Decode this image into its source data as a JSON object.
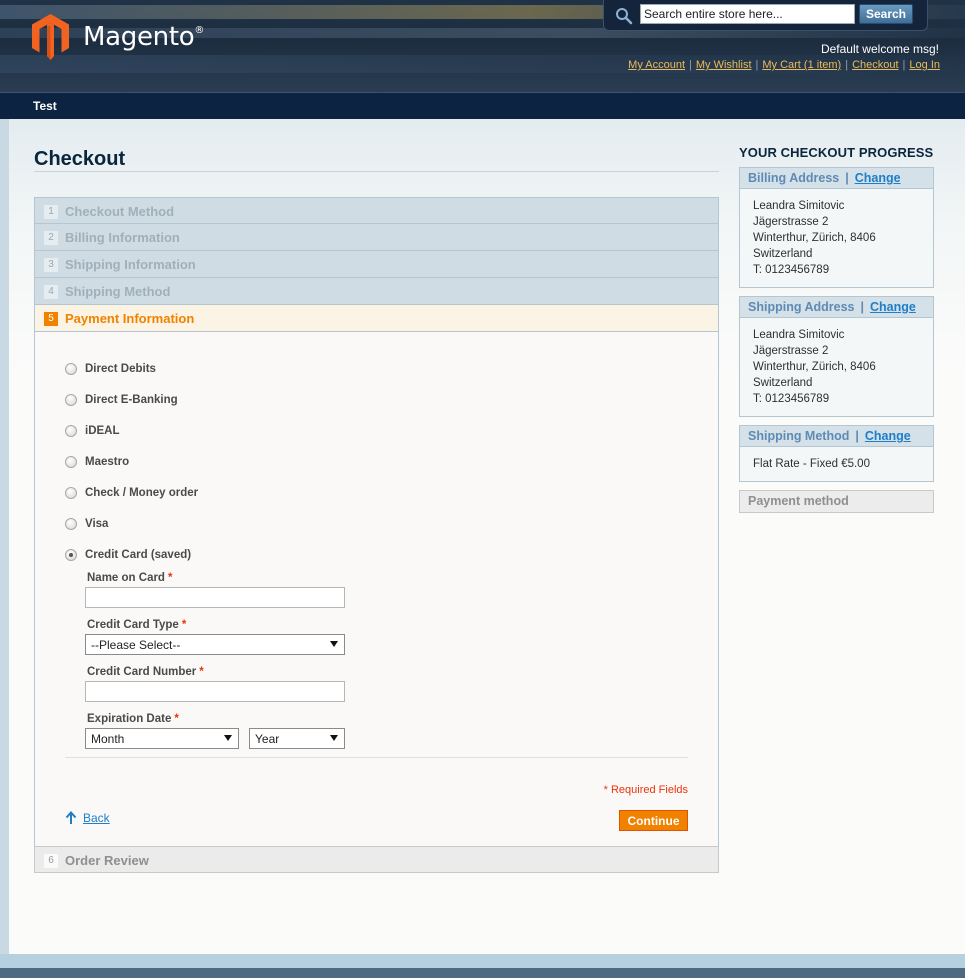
{
  "header": {
    "logo_text": "Magento",
    "logo_reg": "®",
    "search_placeholder": "Search entire store here...",
    "search_button": "Search",
    "welcome": "Default welcome msg!",
    "links": [
      "My Account",
      "My Wishlist",
      "My Cart (1 item)",
      "Checkout",
      "Log In"
    ],
    "separator": "|"
  },
  "nav": {
    "item": "Test"
  },
  "page": {
    "title": "Checkout"
  },
  "steps": [
    {
      "num": "1",
      "label": "Checkout Method"
    },
    {
      "num": "2",
      "label": "Billing Information"
    },
    {
      "num": "3",
      "label": "Shipping Information"
    },
    {
      "num": "4",
      "label": "Shipping Method"
    },
    {
      "num": "5",
      "label": "Payment Information"
    },
    {
      "num": "6",
      "label": "Order Review"
    }
  ],
  "payment": {
    "methods": [
      "Direct Debits",
      "Direct E-Banking",
      "iDEAL",
      "Maestro",
      "Check / Money order",
      "Visa",
      "Credit Card (saved)"
    ],
    "selected": "Credit Card (saved)",
    "fields": {
      "name_label": "Name on Card",
      "type_label": "Credit Card Type",
      "type_value": "--Please Select--",
      "number_label": "Credit Card Number",
      "exp_label": "Expiration Date",
      "month_value": "Month",
      "year_value": "Year",
      "req": "*"
    },
    "required_note": "* Required Fields",
    "back": "Back",
    "continue": "Continue"
  },
  "sidebar": {
    "title": "YOUR CHECKOUT PROGRESS",
    "change": "Change",
    "billing": {
      "title": "Billing Address",
      "lines": [
        "Leandra Simitovic",
        "Jägerstrasse 2",
        "Winterthur, Zürich, 8406",
        "Switzerland",
        "T: 0123456789"
      ]
    },
    "shipping": {
      "title": "Shipping Address",
      "lines": [
        "Leandra Simitovic",
        "Jägerstrasse 2",
        "Winterthur, Zürich, 8406",
        "Switzerland",
        "T: 0123456789"
      ]
    },
    "shipping_method": {
      "title": "Shipping Method",
      "value": "Flat Rate - Fixed €5.00"
    },
    "payment_method": {
      "title": "Payment method"
    }
  },
  "colors": {
    "accent": "#f18200",
    "link": "#1e7ec8",
    "required": "#eb340a",
    "nav": "#0c2441"
  }
}
